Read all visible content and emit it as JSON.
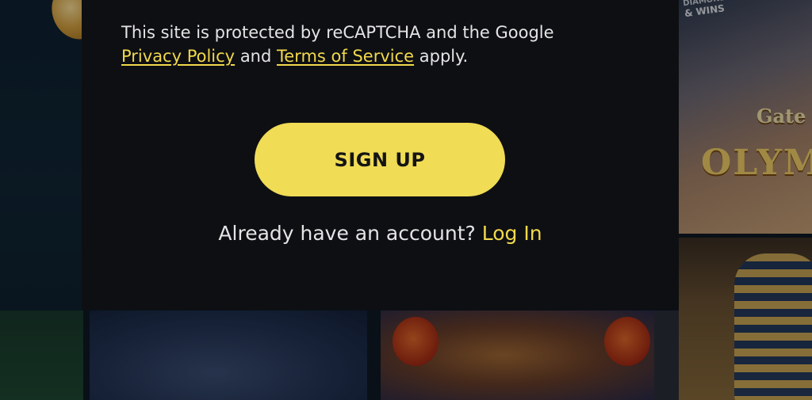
{
  "modal": {
    "recaptcha_text_prefix": "This site is protected by reCAPTCHA and the Google",
    "privacy_link": "Privacy Policy",
    "and_text": "and",
    "terms_link": "Terms of Service",
    "apply_text": "apply.",
    "signup_label": "SIGN UP",
    "already_text": "Already have an account?",
    "login_link": "Log In"
  },
  "background": {
    "badge_text": [
      "DIAMONDS",
      "& WINS"
    ],
    "game_logo": "OLYM",
    "game_logo_small": "Gate"
  },
  "colors": {
    "accent": "#f0dc55",
    "modal_bg": "#0e0f13",
    "text": "#e4e4e4"
  }
}
